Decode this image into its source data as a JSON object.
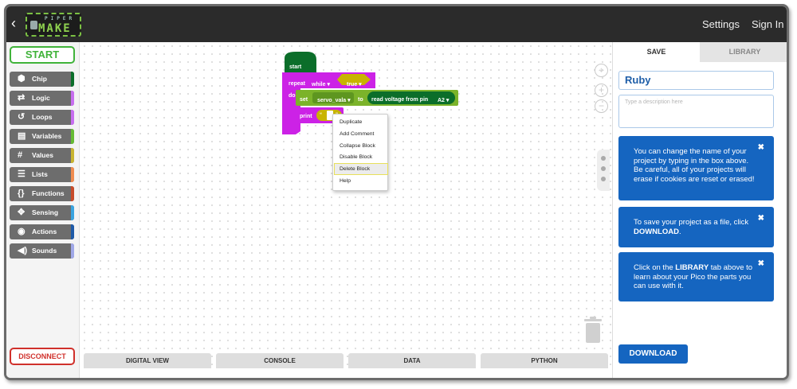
{
  "header": {
    "back_icon": "chevron-left-icon",
    "logo": {
      "top_text": "PIPER",
      "main_text": "MAKE"
    },
    "nav": [
      "Settings",
      "Sign In"
    ]
  },
  "sidebar": {
    "start_label": "START",
    "categories": [
      {
        "label": "Chip",
        "icon": "hexagon-icon",
        "glyph": "⬢",
        "color": "#0b6e2a"
      },
      {
        "label": "Logic",
        "icon": "shuffle-icon",
        "glyph": "⇄",
        "color": "#c86ef0"
      },
      {
        "label": "Loops",
        "icon": "loop-icon",
        "glyph": "↺",
        "color": "#c86ef0"
      },
      {
        "label": "Variables",
        "icon": "list-box-icon",
        "glyph": "▤",
        "color": "#66bb33"
      },
      {
        "label": "Values",
        "icon": "hash-icon",
        "glyph": "#",
        "color": "#c8b430"
      },
      {
        "label": "Lists",
        "icon": "list-icon",
        "glyph": "☰",
        "color": "#f08c50"
      },
      {
        "label": "Functions",
        "icon": "braces-icon",
        "glyph": "{}",
        "color": "#c84c2a"
      },
      {
        "label": "Sensing",
        "icon": "gamepad-icon",
        "glyph": "✥",
        "color": "#3aa4e0"
      },
      {
        "label": "Actions",
        "icon": "target-icon",
        "glyph": "◉",
        "color": "#1e5aa8"
      },
      {
        "label": "Sounds",
        "icon": "speaker-icon",
        "glyph": "◀)",
        "color": "#a0a8e8"
      }
    ],
    "disconnect_label": "DISCONNECT"
  },
  "workspace": {
    "blocks": {
      "start_label": "start",
      "repeat_label": "repeat",
      "while_label": "while",
      "true_label": "true",
      "do_label": "do",
      "set_label": "set",
      "variable_label": "servo_vala",
      "to_label": "to",
      "read_label": "read voltage from pin",
      "pin_label": "A2",
      "print_label": "print",
      "quote_open": "“",
      "quote_close": "”"
    },
    "context_menu": [
      "Duplicate",
      "Add Comment",
      "Collapse Block",
      "Disable Block",
      "Delete Block",
      "Help"
    ],
    "highlighted_item": "Delete Block"
  },
  "bottom_tabs": [
    "DIGITAL VIEW",
    "CONSOLE",
    "DATA",
    "PYTHON"
  ],
  "panel": {
    "tabs": [
      "SAVE",
      "LIBRARY"
    ],
    "active_tab": "SAVE",
    "project_name": "Ruby",
    "description_placeholder": "Type a description here",
    "tips": [
      {
        "text": "You can change the name of your project by typing in the box above. Be careful, all of your projects will erase if cookies are reset or erased!"
      },
      {
        "before": "To save your project as a file, click ",
        "bold": "DOWNLOAD",
        "after": "."
      },
      {
        "before": "Click on the ",
        "bold": "LIBRARY",
        "after": " tab above to learn about your Pico the parts you can use with it."
      }
    ],
    "close_glyph": "✖",
    "download_label": "DOWNLOAD"
  },
  "colors": {
    "start_green": "#40b33a",
    "disconnect_red": "#d0302b",
    "tip_blue": "#1565c0",
    "block_dark_green": "#0b6e2a",
    "block_purple": "#cc22e6",
    "block_olive": "#c8b400",
    "block_lime": "#7bb32a"
  }
}
